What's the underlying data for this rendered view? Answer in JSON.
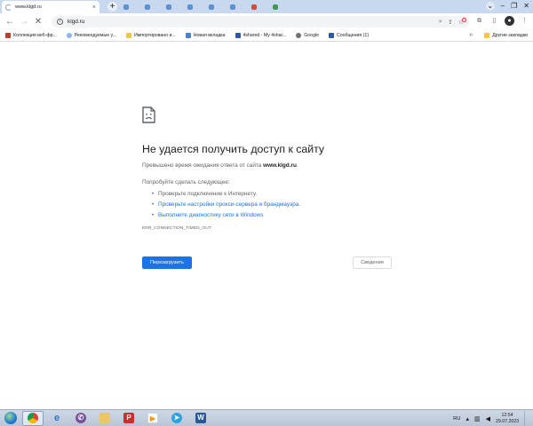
{
  "browser": {
    "active_tab": {
      "title": "www.klgd.ru",
      "icon": "loading-spinner-icon"
    },
    "other_tabs": [
      {
        "icon": "favicon-blue-icon"
      },
      {
        "icon": "favicon-blue-icon"
      },
      {
        "icon": "favicon-blue-icon"
      },
      {
        "icon": "favicon-blue-icon"
      },
      {
        "icon": "favicon-blue-icon"
      },
      {
        "icon": "favicon-blue-icon"
      },
      {
        "icon": "favicon-red-icon"
      },
      {
        "icon": "favicon-green-icon"
      }
    ],
    "new_tab_label": "+",
    "address": "klgd.ru",
    "bookmarks": [
      {
        "label": "Коллекция веб-фр...",
        "icon": "pinterest-icon"
      },
      {
        "label": "Рекомендуемые у...",
        "icon": "search-icon"
      },
      {
        "label": "Импортировано и...",
        "icon": "folder-icon"
      },
      {
        "label": "Новая вкладка",
        "icon": "page-icon"
      },
      {
        "label": "4shared - My 4shar...",
        "icon": "4shared-icon"
      },
      {
        "label": "Google",
        "icon": "globe-icon"
      },
      {
        "label": "Сообщения (1)",
        "icon": "messages-icon"
      }
    ],
    "bookmarks_more": "»",
    "other_bookmarks": "Другие закладки"
  },
  "error_page": {
    "title": "Не удается получить доступ к сайту",
    "desc_prefix": "Превышено время ожидания ответа от сайта ",
    "desc_host": "www.klgd.ru",
    "desc_suffix": ".",
    "try_label": "Попробуйте сделать следующее:",
    "suggestions": [
      {
        "text": "Проверьте подключение к Интернету.",
        "link": false
      },
      {
        "text": "Проверьте настройки прокси-сервера и брандмауэра.",
        "link": true
      },
      {
        "text": "Выполните диагностику сети в Windows",
        "link": true
      }
    ],
    "error_code": "ERR_CONNECTION_TIMED_OUT",
    "reload_button": "Перезагрузить",
    "details_button": "Сведения"
  },
  "taskbar": {
    "apps": [
      {
        "name": "chrome",
        "glyph": "",
        "active": true
      },
      {
        "name": "internet-explorer",
        "glyph": "e",
        "active": false
      },
      {
        "name": "viber",
        "glyph": "✆",
        "active": false
      },
      {
        "name": "file-explorer",
        "glyph": "",
        "active": false
      },
      {
        "name": "sabbath-app",
        "glyph": "P",
        "active": false
      },
      {
        "name": "media-player",
        "glyph": "▶",
        "active": false
      },
      {
        "name": "telegram",
        "glyph": "➤",
        "active": false
      },
      {
        "name": "word",
        "glyph": "W",
        "active": false
      }
    ],
    "language": "RU",
    "time": "12:54",
    "date": "29.07.2023"
  }
}
